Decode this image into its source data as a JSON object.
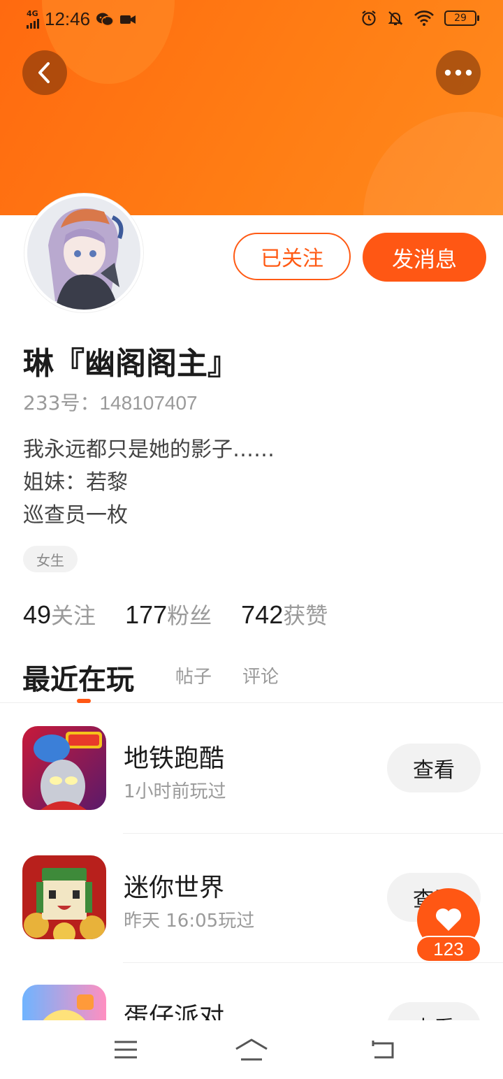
{
  "status_bar": {
    "network": "4G",
    "time": "12:46",
    "battery": "29"
  },
  "profile": {
    "follow_label": "已关注",
    "message_label": "发消息",
    "name": "琳『幽阁阁主』",
    "id_label": "233号：",
    "id_value": "148107407",
    "bio_lines": [
      "我永远都只是她的影子……",
      "姐妹：若黎",
      "巡查员一枚"
    ],
    "gender_tag": "女生",
    "stats": [
      {
        "value": "49",
        "label": "关注"
      },
      {
        "value": "177",
        "label": "粉丝"
      },
      {
        "value": "742",
        "label": "获赞"
      }
    ]
  },
  "tabs": [
    {
      "label": "最近在玩",
      "active": true
    },
    {
      "label": "帖子",
      "active": false
    },
    {
      "label": "评论",
      "active": false
    }
  ],
  "games": [
    {
      "name": "地铁跑酷",
      "played": "1小时前玩过",
      "button": "查看"
    },
    {
      "name": "迷你世界",
      "played": "昨天 16:05玩过",
      "button": "查看"
    },
    {
      "name": "蛋仔派对",
      "played": "",
      "button": "查看"
    }
  ],
  "like_fab": {
    "count": "123"
  },
  "colors": {
    "accent": "#ff5714",
    "header": "#ff7a14"
  }
}
